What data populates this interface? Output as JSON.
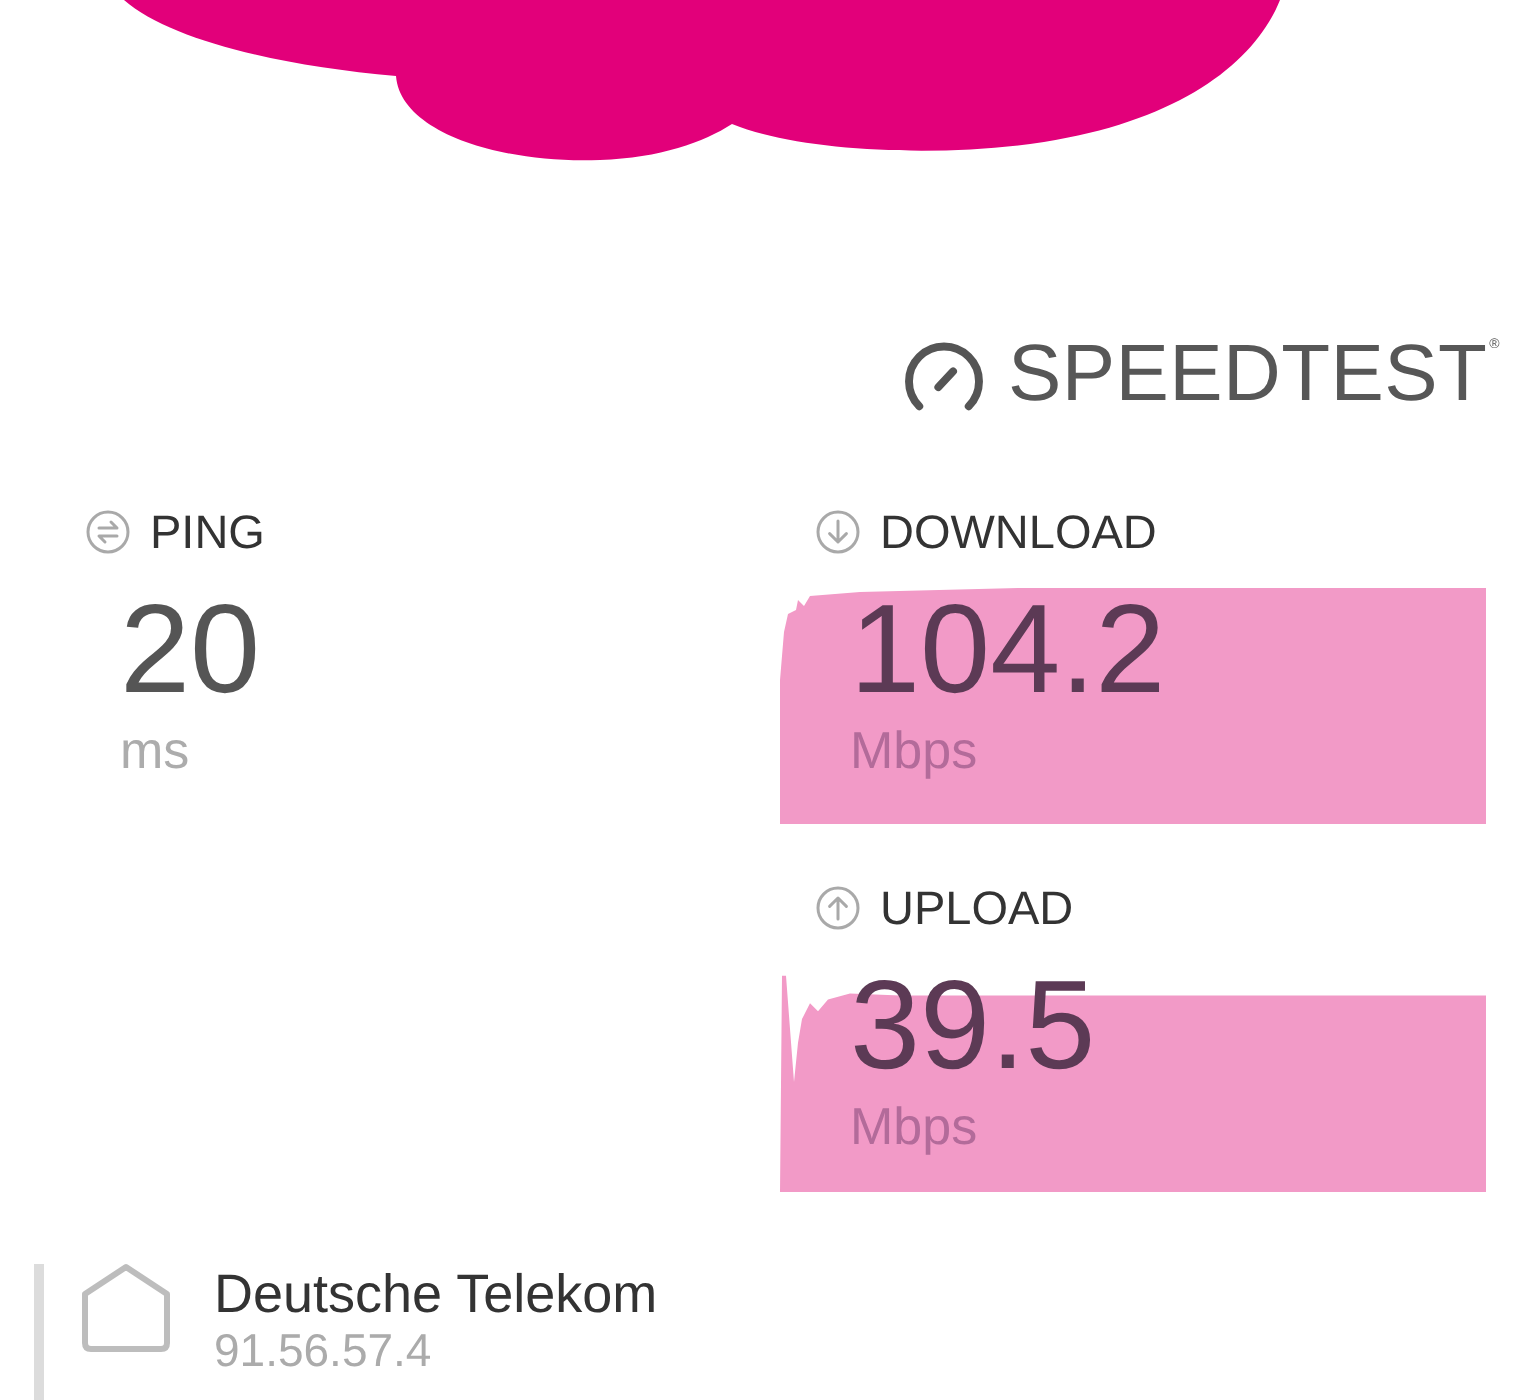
{
  "logo": {
    "text": "SPEEDTEST$^{®}$"
  },
  "metrics": [
    {
      "kind": "ping",
      "label": "PING",
      "value": "20",
      "unit": "ms",
      "highlighted": false
    },
    {
      "kind": "download",
      "label": "DOWNLOAD",
      "value": "104.2",
      "unit": "Mbps",
      "highlighted": true
    },
    {
      "kind": "upload",
      "label": "UPLOAD",
      "value": "39.5",
      "unit": "Mbps",
      "highlighted": true
    }
  ],
  "provider": {
    "name": "Deutsche Telekom",
    "ip": "91.56.57.4"
  }
}
